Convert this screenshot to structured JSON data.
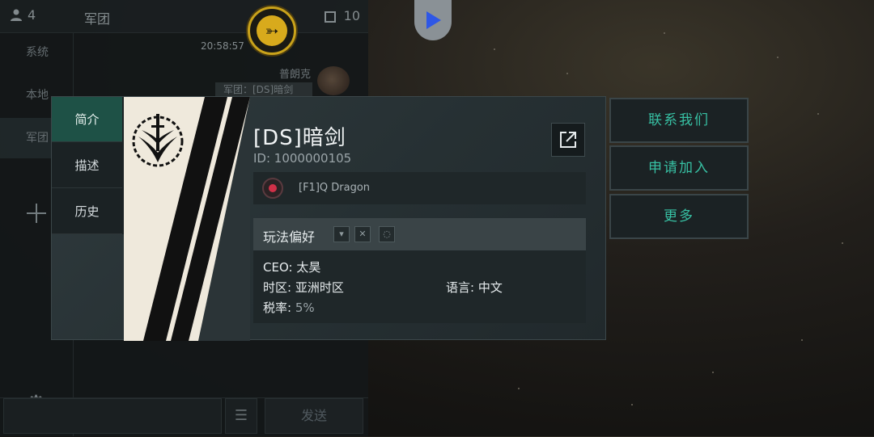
{
  "chat": {
    "member_count": "4",
    "channel_title": "军团",
    "unread_count": "10",
    "channels": [
      "系统",
      "本地",
      "军团"
    ],
    "active_channel": 2,
    "timestamp": "20:58:57",
    "sender": "普朗克",
    "message_preview": "军团：[DS]暗剑",
    "input_placeholder": "",
    "send_label": "发送",
    "menu_glyph": "☰"
  },
  "corp": {
    "tabs": [
      "简介",
      "描述",
      "历史"
    ],
    "active_tab": 0,
    "name": "[DS]暗剑",
    "id_text": "ID: 1000000105",
    "alliance": "[F1]Q Dragon",
    "pref_label": "玩法偏好",
    "ceo": {
      "label": "CEO: ",
      "value": "太昊"
    },
    "timezone": {
      "label": "时区: ",
      "value": "亚洲时区"
    },
    "language": {
      "label": "语言: ",
      "value": "中文"
    },
    "tax": {
      "label": "税率: ",
      "value": "5%"
    }
  },
  "actions": {
    "contact": "联系我们",
    "apply": "申请加入",
    "more": "更多"
  },
  "colors": {
    "accent_teal": "#37c0a3",
    "active_tab": "#1e5146",
    "hud_gold": "#d8aa1c",
    "hud_blue": "#2e57e6"
  },
  "icons": {
    "members": "person-icon",
    "settings": "gear-icon",
    "share": "external-link-icon",
    "hud_left": "drone-icon",
    "hud_right": "play-icon"
  }
}
